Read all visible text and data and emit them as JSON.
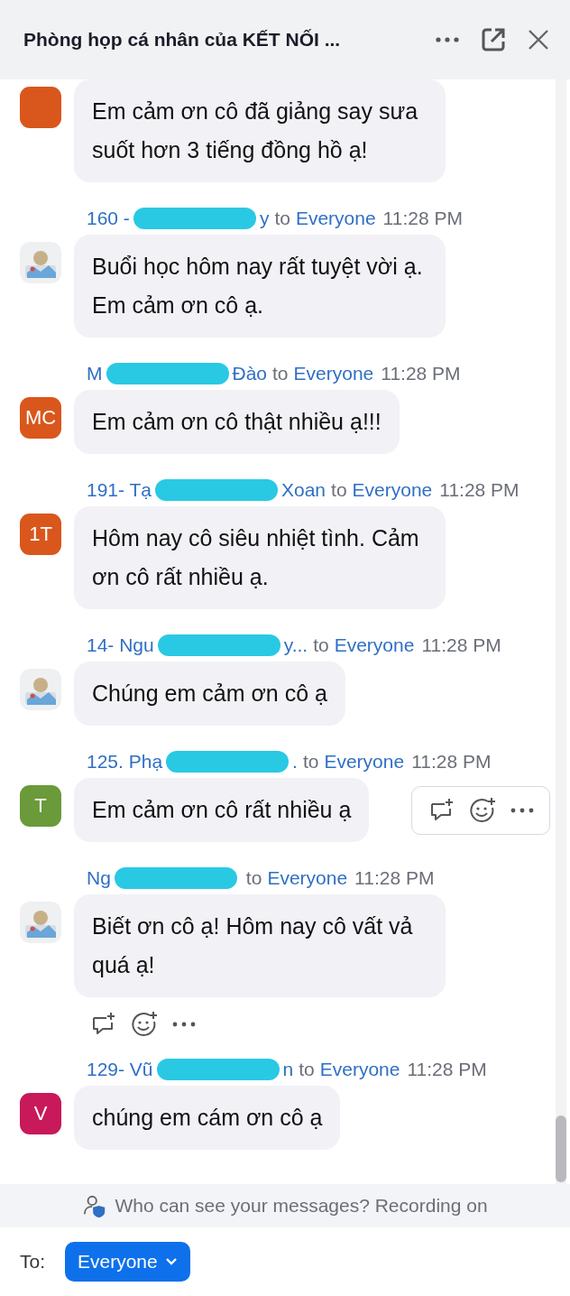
{
  "header": {
    "title": "Phòng họp cá nhân của KẾT NỐI ..."
  },
  "messages": [
    {
      "avatar": {
        "kind": "initials",
        "color": "#d9571c"
      },
      "text": "Em cảm ơn cô đã giảng say sưa suốt hơn 3 tiếng đồng hồ ạ!"
    },
    {
      "sender_start": "160 - ",
      "sender_end": "y",
      "redacted": true,
      "to": "to",
      "recipient": "Everyone",
      "time": "11:28 PM",
      "text": "Buổi học hôm nay rất tuyệt vời ạ. Em cảm ơn cô ạ."
    },
    {
      "sender_start": "M",
      "sender_end": "Đào",
      "redacted": true,
      "to": "to",
      "recipient": "Everyone",
      "time": "11:28 PM",
      "avatar": {
        "kind": "initials",
        "color": "#d9571c",
        "initials": "MC"
      },
      "text": "Em cảm ơn cô thật nhiều ạ!!!"
    },
    {
      "sender_start": "191- Tạ",
      "sender_end": "Xoan",
      "redacted": true,
      "to": "to",
      "recipient": "Everyone",
      "time": "11:28 PM",
      "avatar": {
        "kind": "initials",
        "color": "#d9571c",
        "initials": "1T"
      },
      "text": "Hôm nay cô siêu nhiệt tình. Cảm ơn cô rất nhiều ạ."
    },
    {
      "sender_start": "14- Ngu",
      "sender_end": "y...",
      "redacted": true,
      "to": "to",
      "recipient": "Everyone",
      "time": "11:28 PM",
      "text": "Chúng em cảm ơn cô ạ"
    },
    {
      "sender_start": "125. Phạ",
      "sender_end": ".",
      "redacted": true,
      "to": "to",
      "recipient": "Everyone",
      "time": "11:28 PM",
      "avatar": {
        "kind": "initials",
        "color": "#6a9a3a",
        "initials": "T"
      },
      "text": "Em cảm ơn cô rất nhiều ạ",
      "hover_toolbar": true
    },
    {
      "sender_start": "Ng",
      "redacted": true,
      "to": "to",
      "recipient": "Everyone",
      "time": "11:28 PM",
      "text": "Biết ơn cô ạ! Hôm nay cô vất vả quá ạ!",
      "actions_row": true
    },
    {
      "sender_start": "129- Vũ",
      "sender_end": "n",
      "redacted": true,
      "to": "to",
      "recipient": "Everyone",
      "time": "11:28 PM",
      "avatar": {
        "kind": "initials",
        "color": "#c8195a",
        "initials": "V"
      },
      "text": "chúng em cám ơn cô ạ"
    }
  ],
  "notice": "Who can see your messages? Recording on",
  "composer": {
    "to_label": "To:",
    "recipient": "Everyone"
  }
}
